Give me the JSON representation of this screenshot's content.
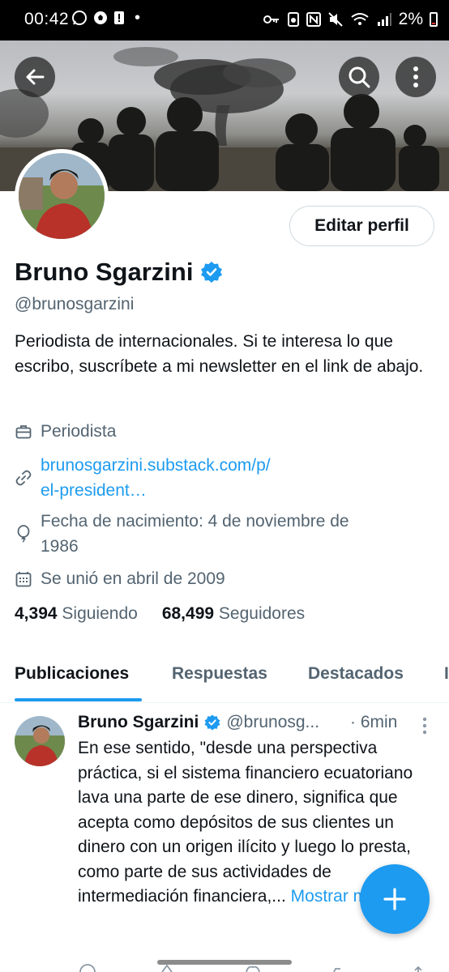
{
  "status_bar": {
    "time": "00:42",
    "battery": "2%"
  },
  "header": {
    "banner_alt": "",
    "back_icon": "arrow-left-icon",
    "search_icon": "search-icon",
    "more_icon": "more-vertical-icon"
  },
  "profile": {
    "edit_label": "Editar perfil",
    "name": "Bruno Sgarzini",
    "handle": "@brunosgarzini",
    "bio": "Periodista de internacionales. Si te interesa lo que escribo, suscríbete a mi newsletter en el link de abajo.",
    "profession": "Periodista",
    "link": "brunosgarzini.substack.com/p/\nel-president…",
    "link_line1": "brunosgarzini.substack.com/p/",
    "link_line2": "el-president…",
    "birth_line1": "Fecha de nacimiento: 4 de noviembre de",
    "birth_line2": "1986",
    "joined": "Se unió en abril de 2009",
    "following_count": "4,394",
    "following_label": "Siguiendo",
    "followers_count": "68,499",
    "followers_label": "Seguidores"
  },
  "tabs": [
    {
      "label": "Publicaciones",
      "active": true
    },
    {
      "label": "Respuestas",
      "active": false
    },
    {
      "label": "Destacados",
      "active": false
    },
    {
      "label": "I",
      "active": false
    }
  ],
  "tweet": {
    "name": "Bruno Sgarzini",
    "handle": "@brunosg...",
    "time": "· 6min",
    "text": "En ese sentido,  \"desde una perspectiva práctica, si el sistema financiero ecuatoriano lava una parte de ese dinero, significa que acepta como depósitos de sus clientes un dinero con un origen ilícito y luego lo presta, como parte de sus actividades de intermediación financiera,...",
    "show_more": "Mostrar más"
  },
  "colors": {
    "accent": "#1d9bf0",
    "text_primary": "#0f1419",
    "text_secondary": "#536471",
    "verified": "#1d9bf0"
  }
}
